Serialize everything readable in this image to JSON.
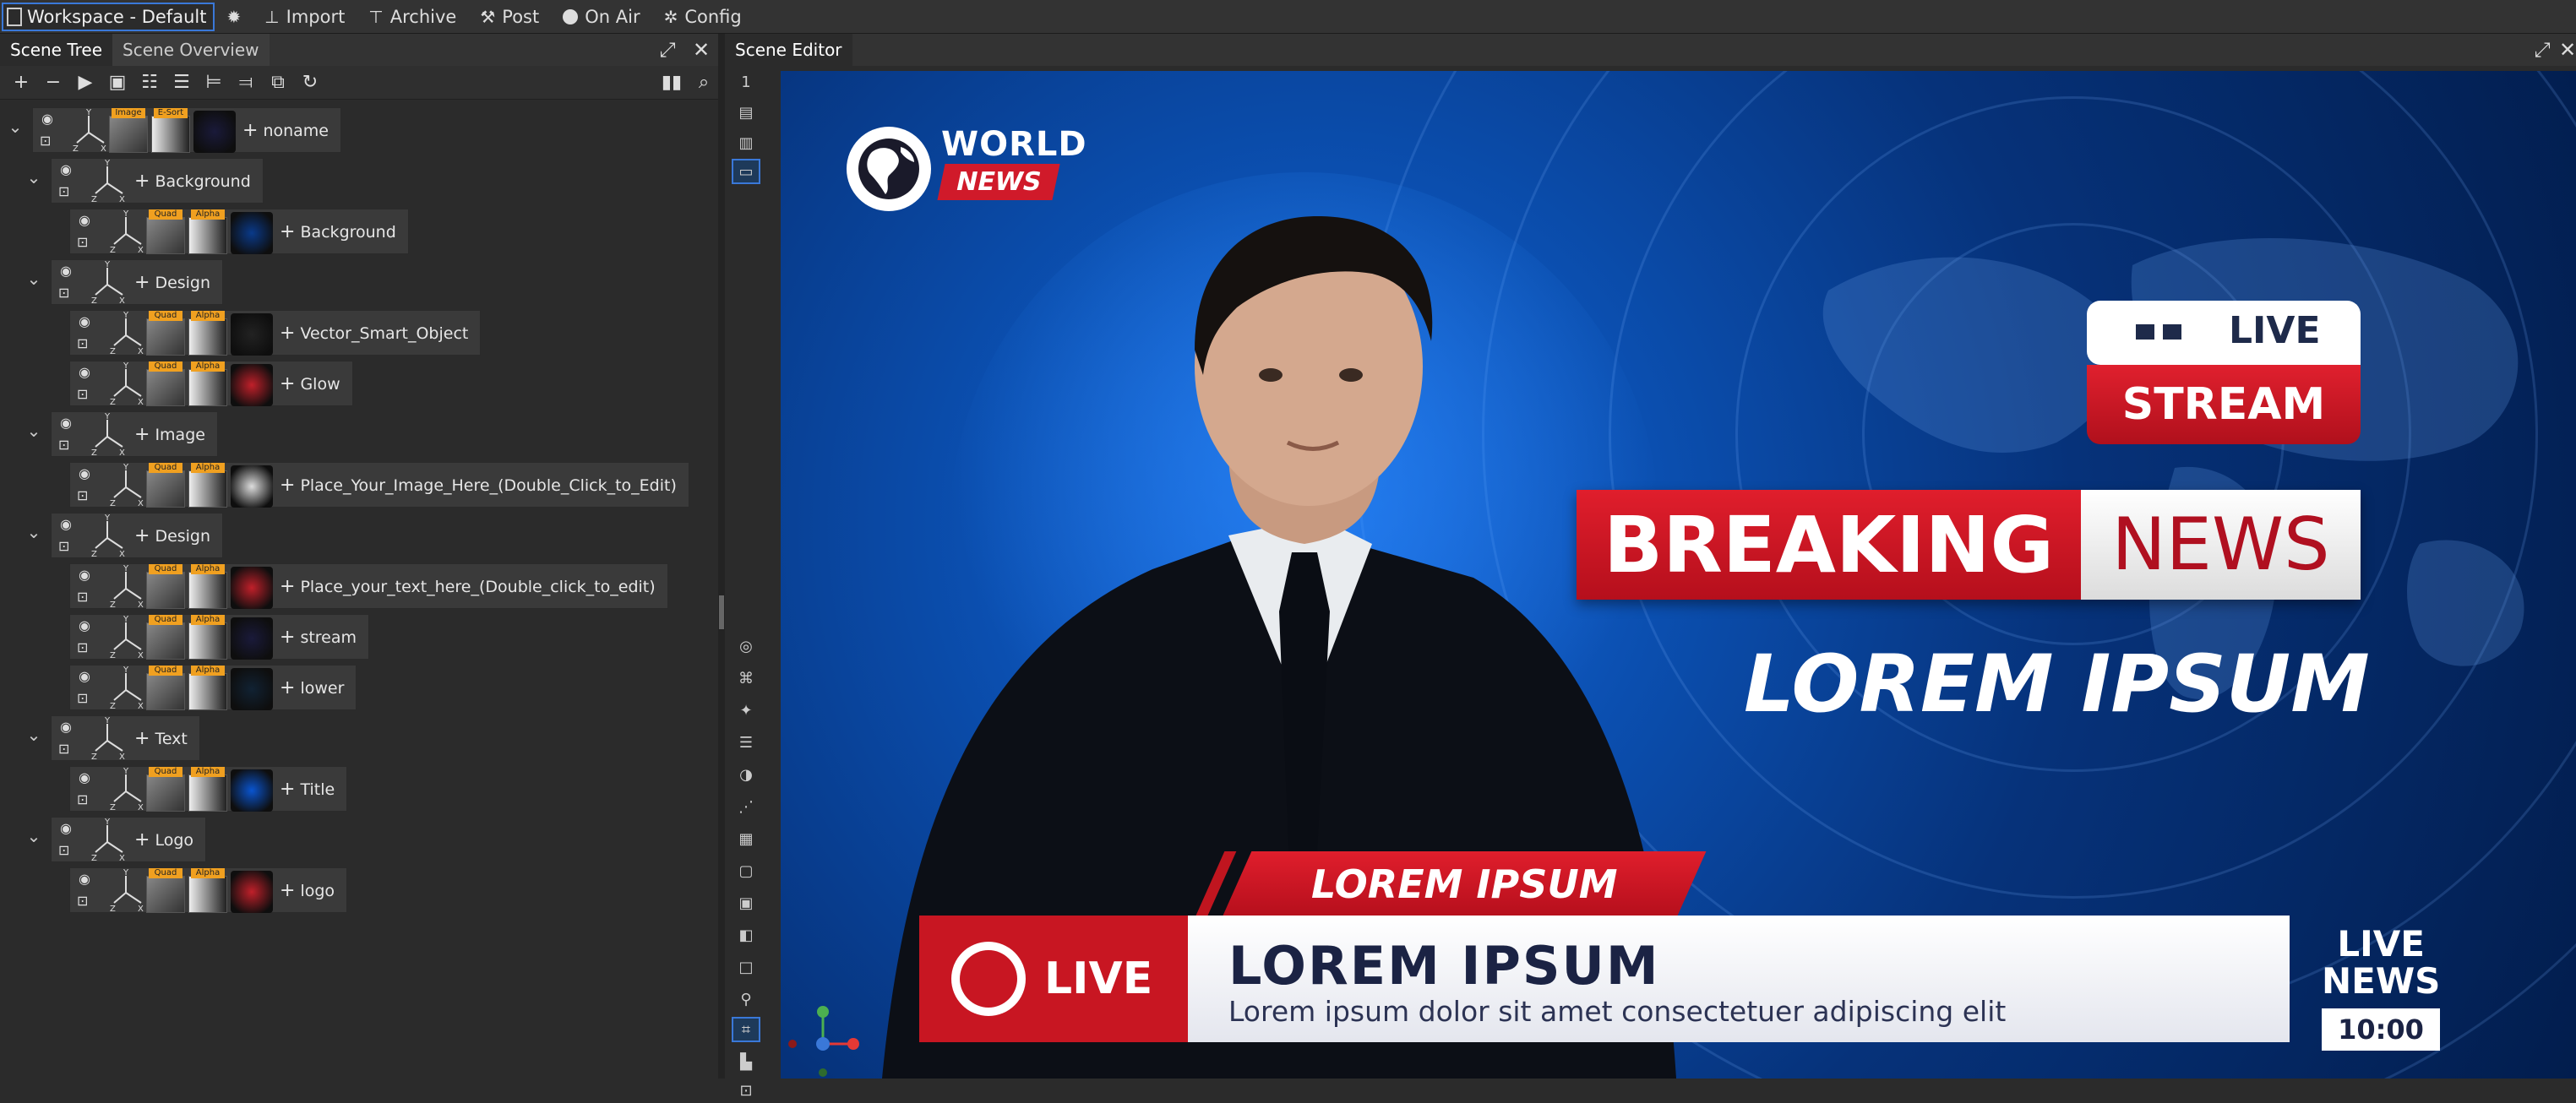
{
  "topbar": {
    "workspace": "Workspace - Default",
    "items": [
      {
        "label": "Import",
        "icon": "import-icon"
      },
      {
        "label": "Archive",
        "icon": "archive-icon"
      },
      {
        "label": "Post",
        "icon": "post-icon"
      },
      {
        "label": "On Air",
        "icon": "on-air-dot-icon"
      },
      {
        "label": "Config",
        "icon": "gear-icon"
      }
    ]
  },
  "left_panel": {
    "tabs": [
      "Scene Tree",
      "Scene Overview"
    ],
    "tree": [
      {
        "level": 0,
        "label": "noname",
        "badges": [
          "Image",
          "E-Sort"
        ],
        "expanded": true
      },
      {
        "level": 1,
        "label": "Background",
        "expanded": true
      },
      {
        "level": 2,
        "label": "Background",
        "badges": [
          "Quad",
          "Alpha"
        ]
      },
      {
        "level": 1,
        "label": "Design",
        "expanded": true
      },
      {
        "level": 2,
        "label": "Vector_Smart_Object",
        "badges": [
          "Quad",
          "Alpha"
        ]
      },
      {
        "level": 2,
        "label": "Glow",
        "badges": [
          "Quad",
          "Alpha"
        ]
      },
      {
        "level": 1,
        "label": "Image",
        "expanded": true
      },
      {
        "level": 2,
        "label": "Place_Your_Image_Here_(Double_Click_to_Edit)",
        "badges": [
          "Quad",
          "Alpha"
        ]
      },
      {
        "level": 1,
        "label": "Design",
        "expanded": true
      },
      {
        "level": 2,
        "label": "Place_your_text_here_(Double_click_to_edit)",
        "badges": [
          "Quad",
          "Alpha"
        ]
      },
      {
        "level": 2,
        "label": "stream",
        "badges": [
          "Quad",
          "Alpha"
        ]
      },
      {
        "level": 2,
        "label": "lower",
        "badges": [
          "Quad",
          "Alpha"
        ]
      },
      {
        "level": 1,
        "label": "Text",
        "expanded": true
      },
      {
        "level": 2,
        "label": "Title",
        "badges": [
          "Quad",
          "Alpha"
        ]
      },
      {
        "level": 1,
        "label": "Logo",
        "expanded": true
      },
      {
        "level": 2,
        "label": "logo",
        "badges": [
          "Quad",
          "Alpha"
        ]
      }
    ]
  },
  "right_panel": {
    "tab": "Scene Editor",
    "layer_number": "1"
  },
  "scene": {
    "logo_world": "WORLD",
    "logo_news": "NEWS",
    "live": "LIVE",
    "stream": "STREAM",
    "breaking": "BREAKING",
    "news": "NEWS",
    "headline": "LOREM IPSUM",
    "lower_tag": "LOREM IPSUM",
    "lower_live": "LIVE",
    "lower_title": "LOREM IPSUM",
    "lower_sub": "Lorem ipsum dolor sit amet consectetuer adipiscing elit",
    "live_news_1": "LIVE",
    "live_news_2": "NEWS",
    "clock": "10:00"
  },
  "colors": {
    "accent_red": "#c81622",
    "navy": "#1b2344",
    "selection_blue": "#3a78d8",
    "badge_orange": "#f0a020"
  }
}
